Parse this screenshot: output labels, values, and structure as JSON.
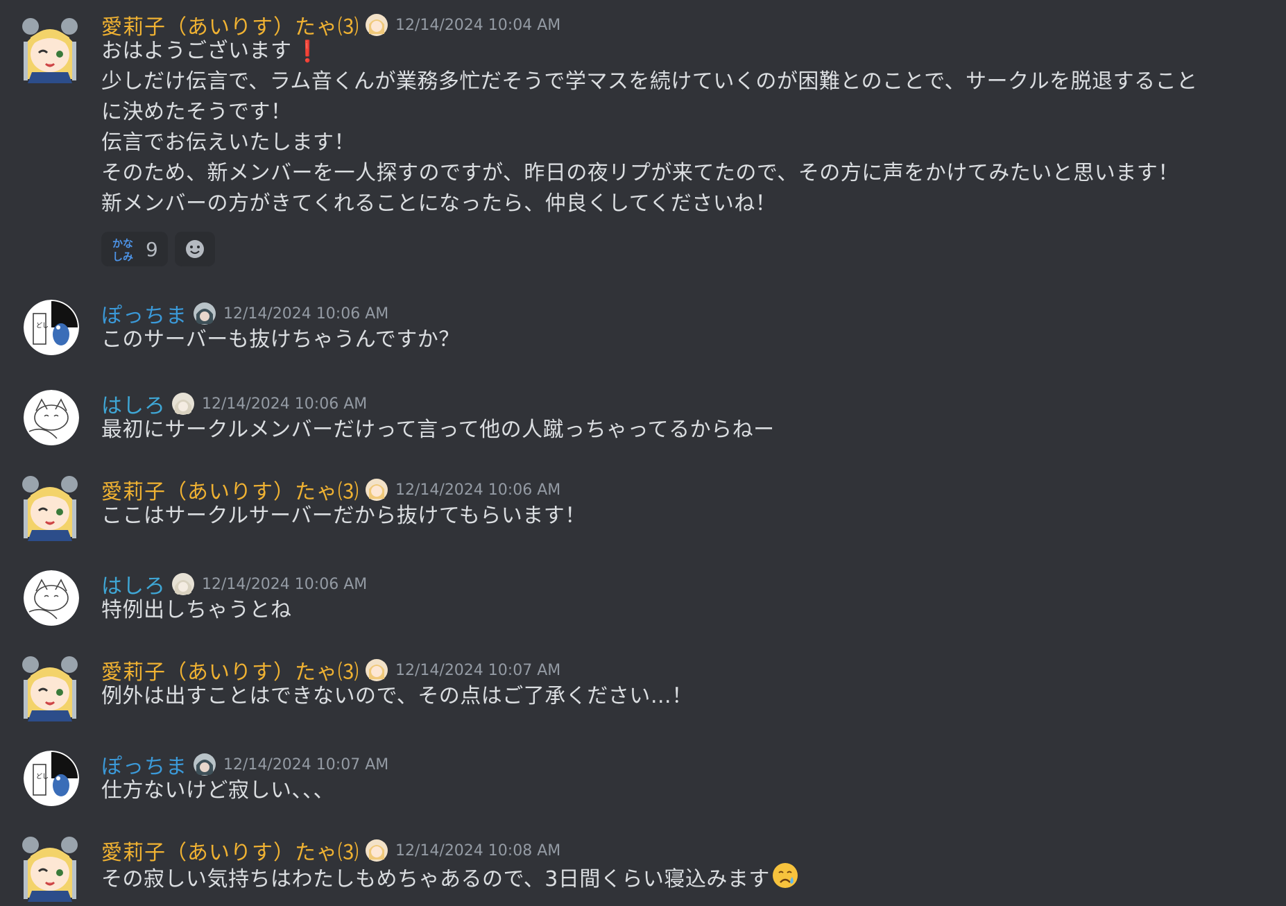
{
  "messages": [
    {
      "username": "愛莉子（あいりす）たゃ⑶",
      "timestamp": "12/14/2024 10:04 AM",
      "name_color": "#f0b232",
      "avatar": "alice-avatar",
      "lines": [
        "おはようございます",
        "少しだけ伝言で、ラム音くんが業務多忙だそうで学マスを続けていくのが困難とのことで、サークルを脱退すること",
        "に決めたそうです！",
        "伝言でお伝えいたします！",
        "そのため、新メンバーを一人探すのですが、昨日の夜リプが来てたので、その方に声をかけてみたいと思います！",
        "新メンバーの方がきてくれることになったら、仲良くしてくださいね！"
      ],
      "line1_emoji": "exclamation-icon",
      "reactions": [
        {
          "label": "かな しみ",
          "count": "9",
          "emoji": "kanashimi-emoji"
        }
      ]
    },
    {
      "username": "ぽっちま",
      "timestamp": "12/14/2024 10:06 AM",
      "name_color": "#3b9ad9",
      "avatar": "pocchima-avatar",
      "lines": [
        "このサーバーも抜けちゃうんですか？"
      ]
    },
    {
      "username": "はしろ",
      "timestamp": "12/14/2024 10:06 AM",
      "name_color": "#3fa7d6",
      "avatar": "hashiro-avatar",
      "lines": [
        "最初にサークルメンバーだけって言って他の人蹴っちゃってるからねー"
      ]
    },
    {
      "username": "愛莉子（あいりす）たゃ⑶",
      "timestamp": "12/14/2024 10:06 AM",
      "name_color": "#f0b232",
      "avatar": "alice-avatar",
      "lines": [
        "ここはサークルサーバーだから抜けてもらいます！"
      ]
    },
    {
      "username": "はしろ",
      "timestamp": "12/14/2024 10:06 AM",
      "name_color": "#3fa7d6",
      "avatar": "hashiro-avatar",
      "lines": [
        "特例出しちゃうとね"
      ]
    },
    {
      "username": "愛莉子（あいりす）たゃ⑶",
      "timestamp": "12/14/2024 10:07 AM",
      "name_color": "#f0b232",
      "avatar": "alice-avatar",
      "lines": [
        "例外は出すことはできないので、その点はご了承ください…！"
      ]
    },
    {
      "username": "ぽっちま",
      "timestamp": "12/14/2024 10:07 AM",
      "name_color": "#3b9ad9",
      "avatar": "pocchima-avatar",
      "lines": [
        "仕方ないけど寂しい、、、"
      ]
    },
    {
      "username": "愛莉子（あいりす）たゃ⑶",
      "timestamp": "12/14/2024 10:08 AM",
      "name_color": "#f0b232",
      "avatar": "alice-avatar",
      "lines": [
        "その寂しい気持ちはわたしもめちゃあるので、3日間くらい寝込みます"
      ],
      "line_end_emoji": "crying-face-icon"
    }
  ]
}
